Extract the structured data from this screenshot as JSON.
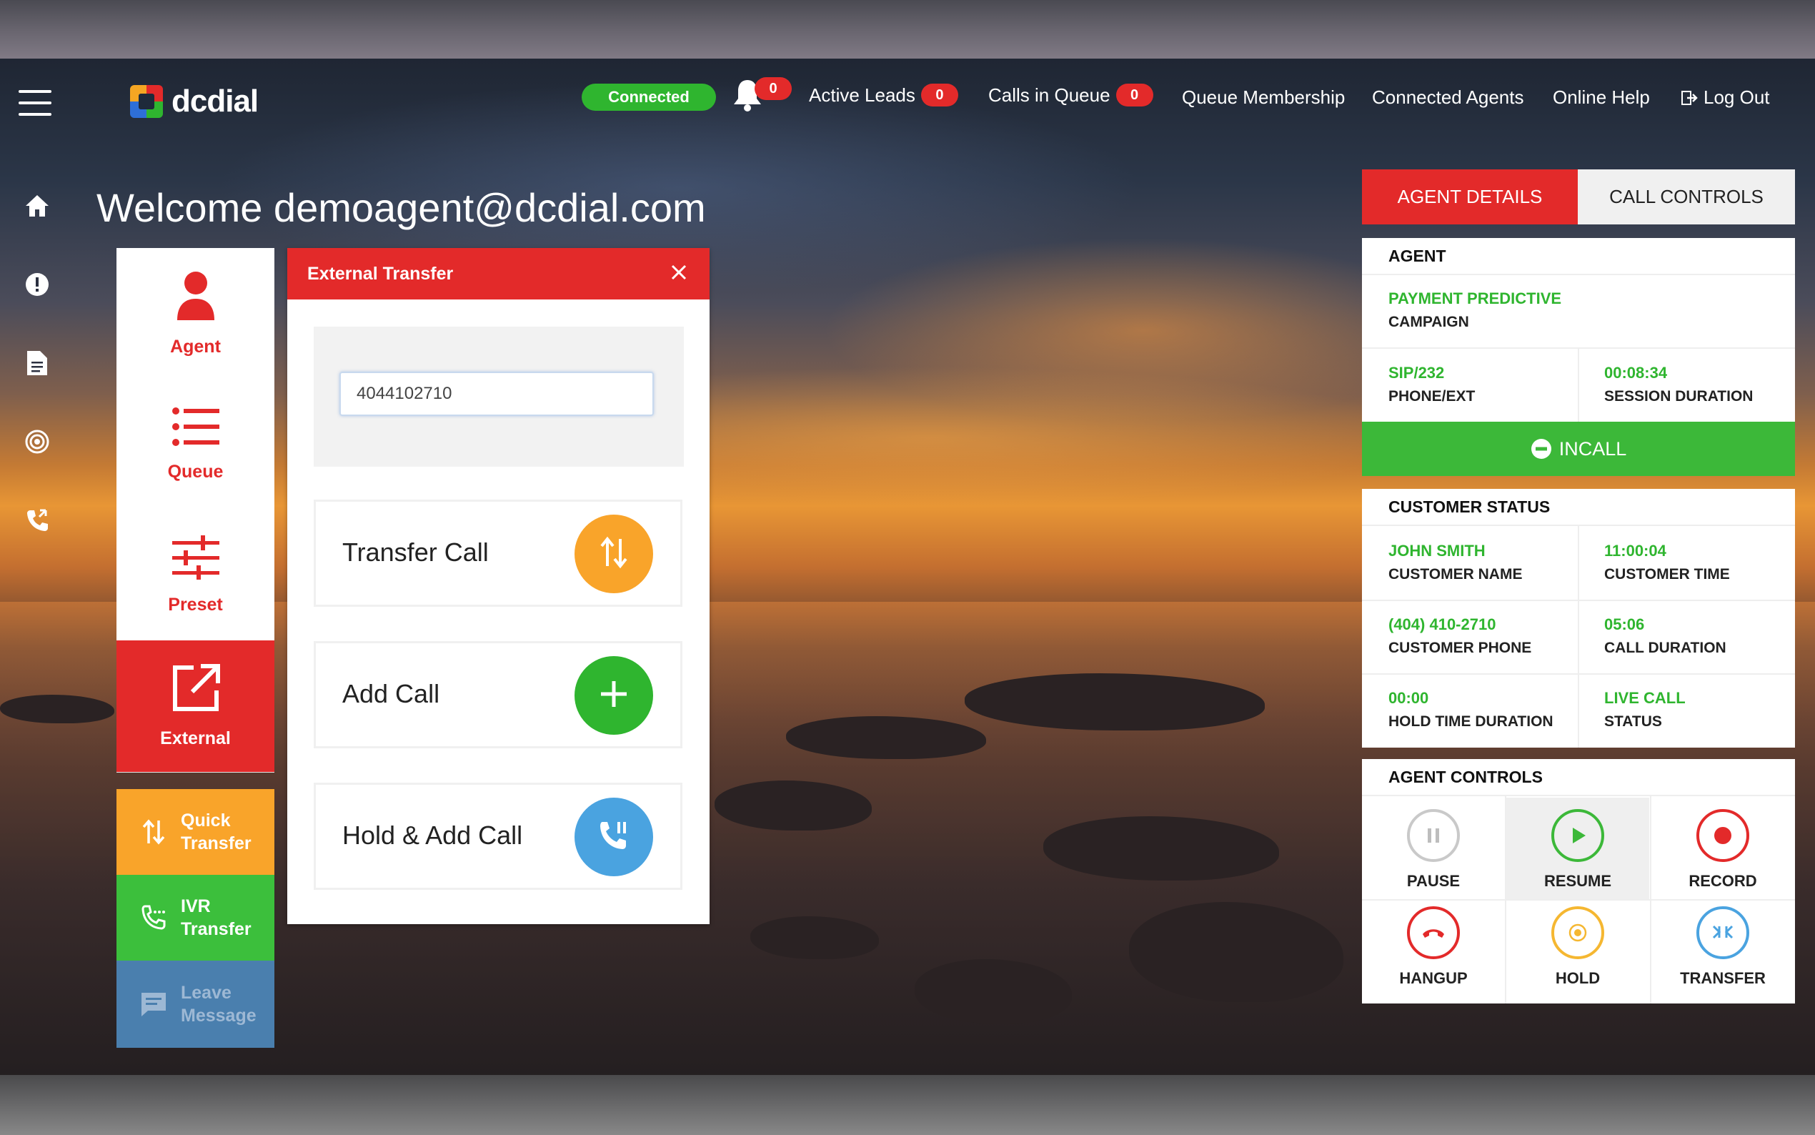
{
  "app": {
    "logo_text": "dcdial"
  },
  "topbar": {
    "status": "Connected",
    "notifications_count": "0",
    "active_leads_label": "Active Leads",
    "active_leads_count": "0",
    "calls_in_queue_label": "Calls in Queue",
    "calls_in_queue_count": "0",
    "queue_membership": "Queue Membership",
    "connected_agents": "Connected Agents",
    "online_help": "Online Help",
    "logout": "Log Out"
  },
  "rail": [
    "home-icon",
    "alert-icon",
    "document-icon",
    "target-icon",
    "phone-transfer-icon"
  ],
  "welcome": "Welcome demoagent@dcdial.com",
  "menu": {
    "agent": "Agent",
    "queue": "Queue",
    "preset": "Preset",
    "external": "External",
    "quick_transfer": "Quick Transfer",
    "ivr_transfer": "IVR Transfer",
    "leave_message": "Leave Message"
  },
  "external_transfer": {
    "title": "External Transfer",
    "phone_value": "4044102710",
    "transfer_call": "Transfer Call",
    "add_call": "Add Call",
    "hold_add_call": "Hold & Add Call"
  },
  "right_panel": {
    "tabs": {
      "agent_details": "AGENT DETAILS",
      "call_controls": "CALL CONTROLS"
    },
    "agent": {
      "heading": "AGENT",
      "campaign_value": "PAYMENT PREDICTIVE",
      "campaign_label": "CAMPAIGN",
      "phone_value": "SIP/232",
      "phone_label": "PHONE/EXT",
      "session_value": "00:08:34",
      "session_label": "SESSION DURATION",
      "state": "INCALL"
    },
    "customer": {
      "heading": "CUSTOMER STATUS",
      "name_value": "JOHN SMITH",
      "name_label": "CUSTOMER NAME",
      "time_value": "11:00:04",
      "time_label": "CUSTOMER TIME",
      "phone_value": "(404) 410-2710",
      "phone_label": "CUSTOMER PHONE",
      "duration_value": "05:06",
      "duration_label": "CALL DURATION",
      "hold_value": "00:00",
      "hold_label": "HOLD TIME DURATION",
      "status_value": "LIVE CALL",
      "status_label": "STATUS"
    },
    "controls": {
      "heading": "AGENT CONTROLS",
      "pause": "PAUSE",
      "resume": "RESUME",
      "record": "RECORD",
      "hangup": "HANGUP",
      "hold": "HOLD",
      "transfer": "TRANSFER"
    }
  },
  "colors": {
    "brand_red": "#e32a2a",
    "green": "#2fb52f",
    "orange": "#f9a42a",
    "blue": "#4aa3e0",
    "ivr_green": "#3cbf3c",
    "leave_blue": "#4a7fae"
  }
}
